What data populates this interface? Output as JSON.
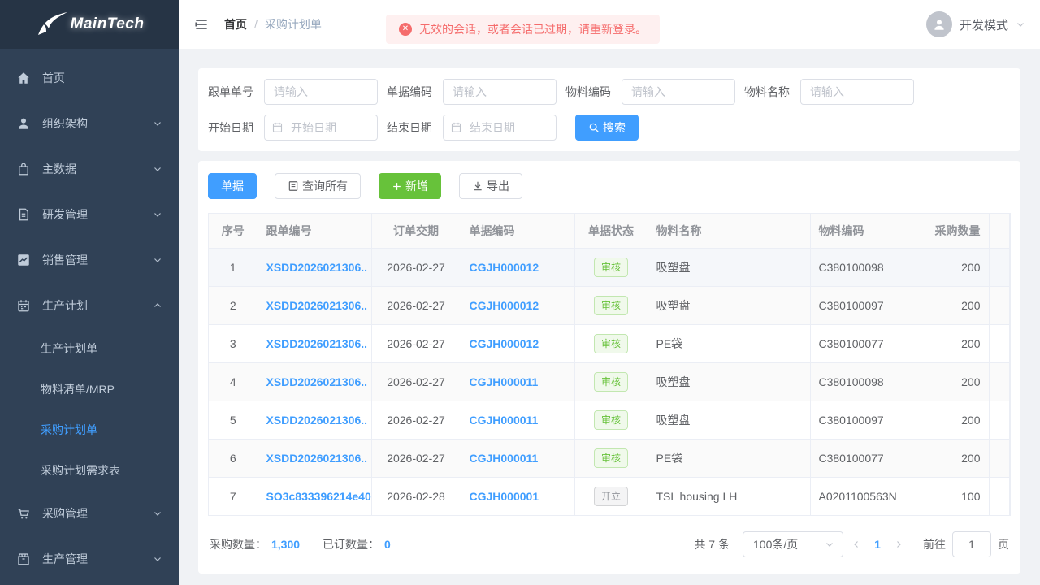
{
  "brand": {
    "name": "MainTech"
  },
  "sidebar": {
    "items": [
      {
        "label": "首页",
        "icon": "home-icon"
      },
      {
        "label": "组织架构",
        "icon": "user-icon"
      },
      {
        "label": "主数据",
        "icon": "bag-icon"
      },
      {
        "label": "研发管理",
        "icon": "document-icon"
      },
      {
        "label": "销售管理",
        "icon": "chart-icon"
      },
      {
        "label": "生产计划",
        "icon": "calendar-icon",
        "expanded": true,
        "children": [
          "生产计划单",
          "物料清单/MRP",
          "采购计划单",
          "采购计划需求表"
        ],
        "active_child": "采购计划单"
      },
      {
        "label": "采购管理",
        "icon": "cart-icon"
      },
      {
        "label": "生产管理",
        "icon": "package-icon"
      }
    ]
  },
  "topbar": {
    "breadcrumb": {
      "root": "首页",
      "separator": "/",
      "current": "采购计划单"
    },
    "alert": {
      "icon": "error-circle-icon",
      "text": "无效的会话，或者会话已过期，请重新登录。"
    },
    "user": {
      "name": "开发模式"
    }
  },
  "filters": {
    "fields": [
      {
        "label": "跟单单号",
        "placeholder": "请输入"
      },
      {
        "label": "单据编码",
        "placeholder": "请输入"
      },
      {
        "label": "物料编码",
        "placeholder": "请输入"
      },
      {
        "label": "物料名称",
        "placeholder": "请输入"
      }
    ],
    "date_fields": [
      {
        "label": "开始日期",
        "placeholder": "开始日期"
      },
      {
        "label": "结束日期",
        "placeholder": "结束日期"
      }
    ],
    "search_label": "搜索"
  },
  "toolbar": {
    "doc_label": "单据",
    "query_all_label": "查询所有",
    "add_label": "新增",
    "export_label": "导出"
  },
  "table": {
    "columns": [
      "序号",
      "跟单编号",
      "订单交期",
      "单据编码",
      "单据状态",
      "物料名称",
      "物料编码",
      "采购数量"
    ],
    "rows": [
      {
        "no": "1",
        "order": "XSDD2026021306..",
        "due": "2026-02-27",
        "doc": "CGJH000012",
        "status": "审核",
        "material": "吸塑盘",
        "code": "C380100098",
        "qty": "200"
      },
      {
        "no": "2",
        "order": "XSDD2026021306..",
        "due": "2026-02-27",
        "doc": "CGJH000012",
        "status": "审核",
        "material": "吸塑盘",
        "code": "C380100097",
        "qty": "200"
      },
      {
        "no": "3",
        "order": "XSDD2026021306..",
        "due": "2026-02-27",
        "doc": "CGJH000012",
        "status": "审核",
        "material": "PE袋",
        "code": "C380100077",
        "qty": "200"
      },
      {
        "no": "4",
        "order": "XSDD2026021306..",
        "due": "2026-02-27",
        "doc": "CGJH000011",
        "status": "审核",
        "material": "吸塑盘",
        "code": "C380100098",
        "qty": "200"
      },
      {
        "no": "5",
        "order": "XSDD2026021306..",
        "due": "2026-02-27",
        "doc": "CGJH000011",
        "status": "审核",
        "material": "吸塑盘",
        "code": "C380100097",
        "qty": "200"
      },
      {
        "no": "6",
        "order": "XSDD2026021306..",
        "due": "2026-02-27",
        "doc": "CGJH000011",
        "status": "审核",
        "material": "PE袋",
        "code": "C380100077",
        "qty": "200"
      },
      {
        "no": "7",
        "order": "SO3c833396214e40",
        "due": "2026-02-28",
        "doc": "CGJH000001",
        "status": "开立",
        "material": "TSL housing LH",
        "code": "A0201100563N",
        "qty": "100"
      }
    ]
  },
  "footer": {
    "purchase_qty_label": "采购数量：",
    "purchase_qty": "1,300",
    "ordered_qty_label": "已订数量：",
    "ordered_qty": "0",
    "total": "共 7 条",
    "page_size": "100条/页",
    "page": "1",
    "goto_label": "前往",
    "goto_value": "1",
    "page_unit": "页"
  },
  "colors": {
    "accent": "#409eff",
    "success": "#67c23a",
    "danger": "#f56c6c",
    "sidebar_bg": "#304156",
    "page_bg": "#f0f2f5"
  }
}
